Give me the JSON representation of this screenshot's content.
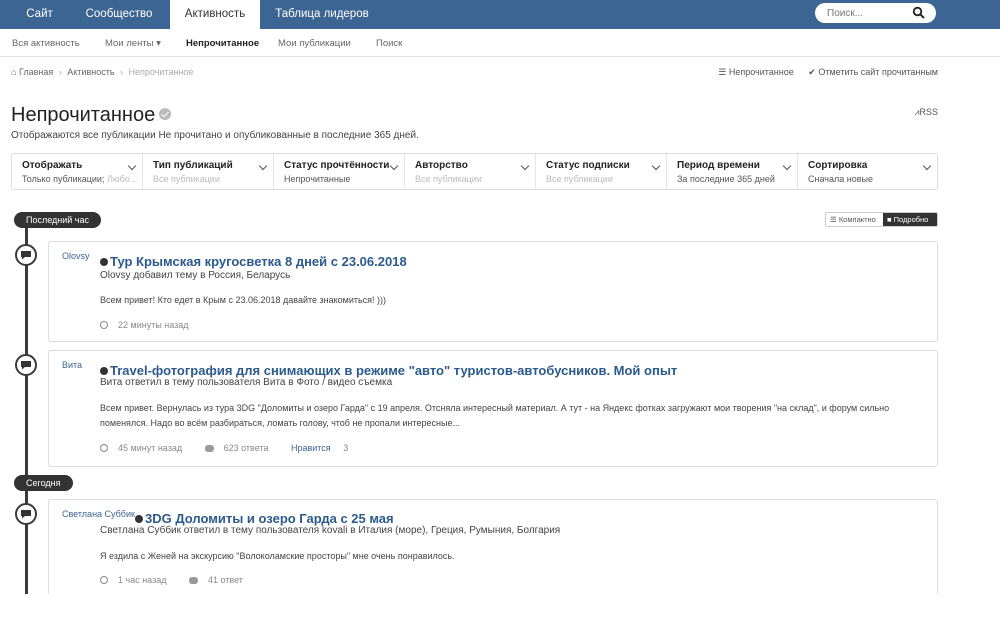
{
  "nav": {
    "tabs": [
      {
        "label": "Сайт"
      },
      {
        "label": "Сообщество"
      },
      {
        "label": "Активность"
      },
      {
        "label": "Таблица лидеров"
      }
    ],
    "search_placeholder": "Поиск..."
  },
  "subnav": {
    "items": [
      {
        "label": "Вся активность"
      },
      {
        "label": "Мои ленты ▾"
      },
      {
        "label": "Непрочитанное"
      },
      {
        "label": "Мои публикации"
      },
      {
        "label": "Поиск"
      }
    ]
  },
  "breadcrumb": {
    "home": "Главная",
    "activity": "Активность",
    "current": "Непрочитанное"
  },
  "actions": {
    "unread": "Непрочитанное",
    "mark_read": "Отметить сайт прочитанным",
    "rss": "RSS"
  },
  "page": {
    "title": "Непрочитанное",
    "subtitle": "Отображаются все публикации Не прочитано и опубликованные в последние 365 дней."
  },
  "filters": [
    {
      "title": "Отображать",
      "value": "Только публикации;",
      "value_muted": " Любо..."
    },
    {
      "title": "Тип публикаций",
      "value": "",
      "value_muted": "Все публикации"
    },
    {
      "title": "Статус прочтённости",
      "value": "Непрочитанные",
      "value_muted": ""
    },
    {
      "title": "Авторство",
      "value": "",
      "value_muted": "Все публикации"
    },
    {
      "title": "Статус подписки",
      "value": "",
      "value_muted": "Все публикации"
    },
    {
      "title": "Период времени",
      "value": "За последние 365 дней",
      "value_muted": ""
    },
    {
      "title": "Сортировка",
      "value": "Сначала новые",
      "value_muted": ""
    }
  ],
  "view_toggle": {
    "compact": "Компактно",
    "full": "Подробно"
  },
  "timeline": {
    "group1": "Последний час",
    "group2": "Сегодня"
  },
  "posts": [
    {
      "author": "Olovsy",
      "title": "Тур Крымская кругосветка 8 дней с 23.06.2018",
      "sub": "Olovsy добавил тему в Россия, Беларусь",
      "body": "Всем привет! Кто едет в Крым с 23.06.2018 давайте знакомиться! )))",
      "time": "22 минуты назад"
    },
    {
      "author": "Вита",
      "title": "Travel-фотография для снимающих в режиме \"авто\" туристов-автобусников. Мой опыт",
      "sub": "Вита ответил в тему пользователя Вита в Фото / видео съемка",
      "body": "Всем привет. Вернулась из тура 3DG \"Доломиты и озеро Гарда\" с 19 апреля. Отсняла интересный материал. А тут - на Яндекс фотках загружают мои творения \"на склад\", и форум сильно поменялся. Надо во всём разбираться, ломать голову, чтоб не пропали интересные...",
      "time": "45 минут назад",
      "replies": "623 ответа",
      "likes_label": "Нравится",
      "likes": "3"
    },
    {
      "author": "Светлана Суббик",
      "title": "3DG Доломиты и озеро Гарда с 25 мая",
      "sub": "Светлана Суббик ответил в тему пользователя kovali в Италия (море), Греция, Румыния, Болгария",
      "body": "Я ездила с Женей на экскурсию \"Волоколамские просторы\" мне очень понравилось.",
      "time": "1 час назад",
      "replies": "41 ответ"
    }
  ]
}
